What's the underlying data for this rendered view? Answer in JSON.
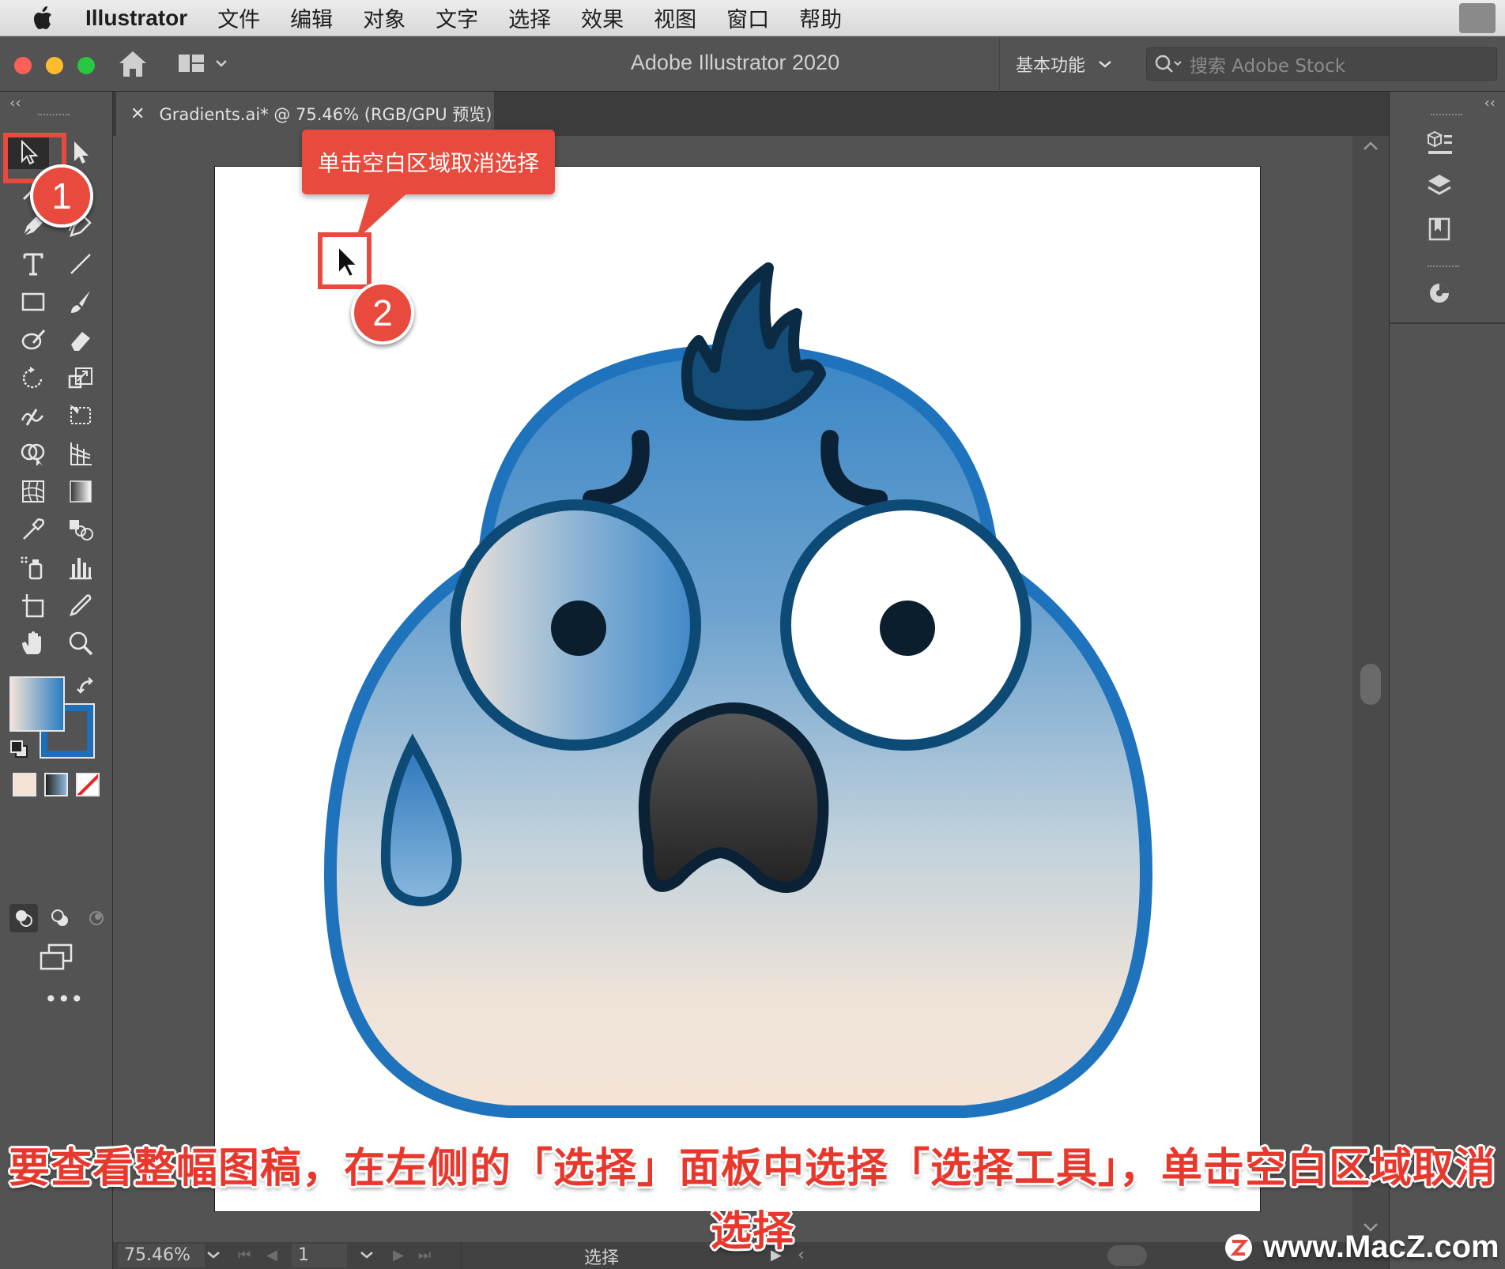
{
  "menubar": {
    "app": "Illustrator",
    "items": [
      "文件",
      "编辑",
      "对象",
      "文字",
      "选择",
      "效果",
      "视图",
      "窗口",
      "帮助"
    ]
  },
  "appbar": {
    "title": "Adobe Illustrator 2020",
    "workspace": "基本功能",
    "search_placeholder": "搜索 Adobe Stock"
  },
  "document": {
    "tab_title": "Gradients.ai* @ 75.46% (RGB/GPU 预览)"
  },
  "statusbar": {
    "zoom": "75.46%",
    "artboard_number": "1",
    "tool_status": "选择"
  },
  "annotations": {
    "callout": "单击空白区域取消选择",
    "marker1": "1",
    "marker2": "2",
    "caption_line1": "要查看整幅图稿，在左侧的「选择」面板中选择「选择工具」，单击空白区域取消",
    "caption_line2": "选择"
  },
  "watermark": "www.MacZ.com",
  "colors": {
    "accent_red": "#e84a3d",
    "panel": "#535353",
    "stroke_blue": "#1f73bd",
    "crest_blue": "#0e4a73"
  }
}
